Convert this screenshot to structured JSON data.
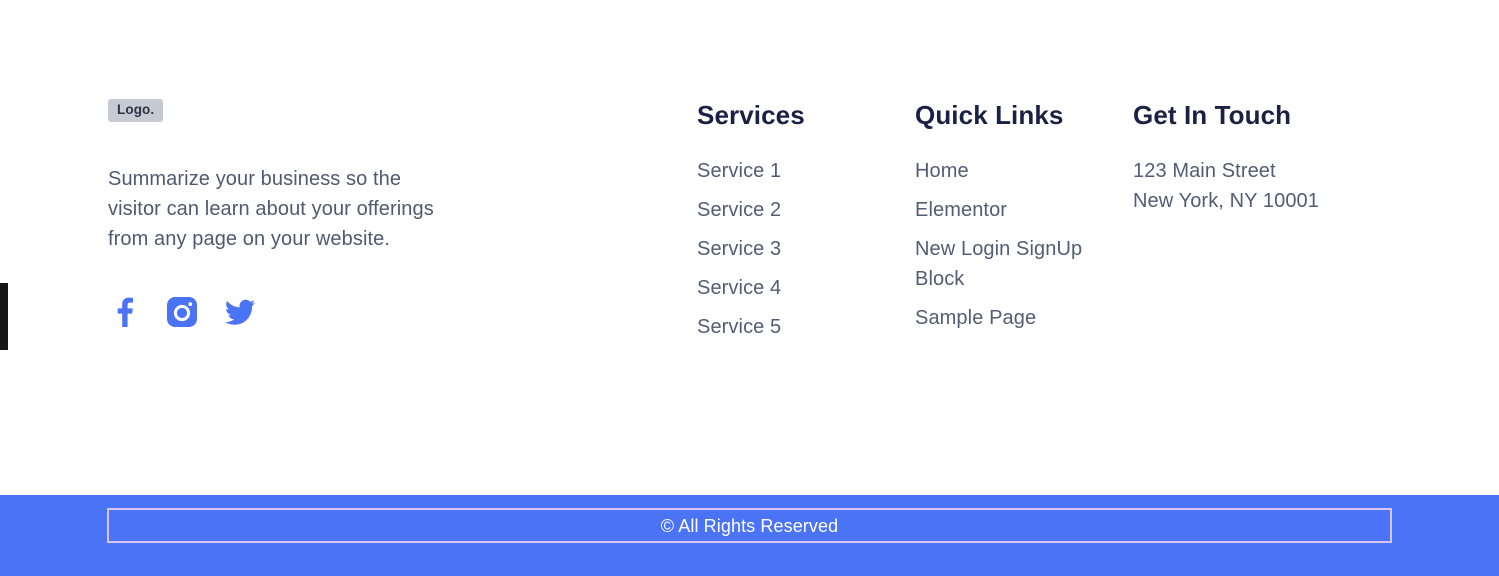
{
  "theme": {
    "page_background": "#ffffff",
    "accent_blue": "#4a74f5",
    "heading_color": "#1b2045",
    "body_text_color": "#525d74",
    "logo_badge_background": "#c6cad2",
    "copyright_border_color": "#dcc3ef",
    "copyright_text_color": "#ffffff",
    "edge_marker_color": "#17171a"
  },
  "brand": {
    "logo_label": "Logo.",
    "description": "Summarize your business so the visitor can learn about your offerings from any page on your website.",
    "social": [
      {
        "name": "facebook",
        "icon": "facebook-icon",
        "label": "Facebook"
      },
      {
        "name": "instagram",
        "icon": "instagram-icon",
        "label": "Instagram"
      },
      {
        "name": "twitter",
        "icon": "twitter-icon",
        "label": "Twitter"
      }
    ]
  },
  "services": {
    "title": "Services",
    "links": [
      {
        "label": "Service 1"
      },
      {
        "label": "Service 2"
      },
      {
        "label": "Service 3"
      },
      {
        "label": "Service 4"
      },
      {
        "label": "Service 5"
      }
    ]
  },
  "quick_links": {
    "title": "Quick Links",
    "links": [
      {
        "label": "Home"
      },
      {
        "label": "Elementor"
      },
      {
        "label": "New Login SignUp Block"
      },
      {
        "label": "Sample Page"
      }
    ]
  },
  "contact": {
    "title": "Get In Touch",
    "address_line_1": "123 Main Street",
    "address_line_2": "New York, NY 10001"
  },
  "bottom_bar": {
    "copyright": "© All Rights Reserved"
  }
}
